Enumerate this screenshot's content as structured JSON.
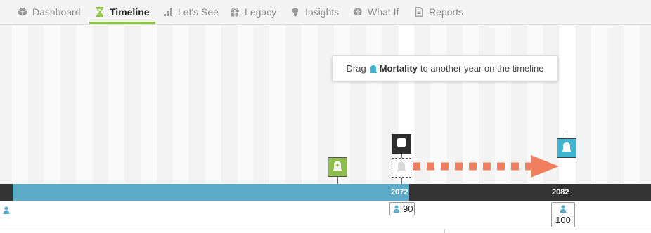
{
  "nav": {
    "tabs": [
      {
        "label": "Dashboard",
        "icon": "cube-icon",
        "active": false
      },
      {
        "label": "Timeline",
        "icon": "hourglass-icon",
        "active": true
      },
      {
        "label": "Let's See",
        "icon": "bar-chart-icon",
        "active": false
      },
      {
        "label": "Legacy",
        "icon": "gift-icon",
        "active": false
      },
      {
        "label": "Insights",
        "icon": "lightbulb-icon",
        "active": false
      },
      {
        "label": "What If",
        "icon": "brain-icon",
        "active": false
      },
      {
        "label": "Reports",
        "icon": "document-icon",
        "active": false
      }
    ]
  },
  "tooltip": {
    "prefix": "Drag",
    "strong": "Mortality",
    "suffix": "to another year on the timeline"
  },
  "timeline": {
    "year_current": "2072",
    "year_target": "2082",
    "age_current": "90",
    "age_target": "100"
  },
  "colors": {
    "accent_green": "#8dc63f",
    "timeline_blue": "#5aaac8",
    "bar_dark": "#333333",
    "mortality_teal": "#42b4d0",
    "marker_green": "#8dbb4b",
    "arrow_orange": "#f07f5f"
  }
}
